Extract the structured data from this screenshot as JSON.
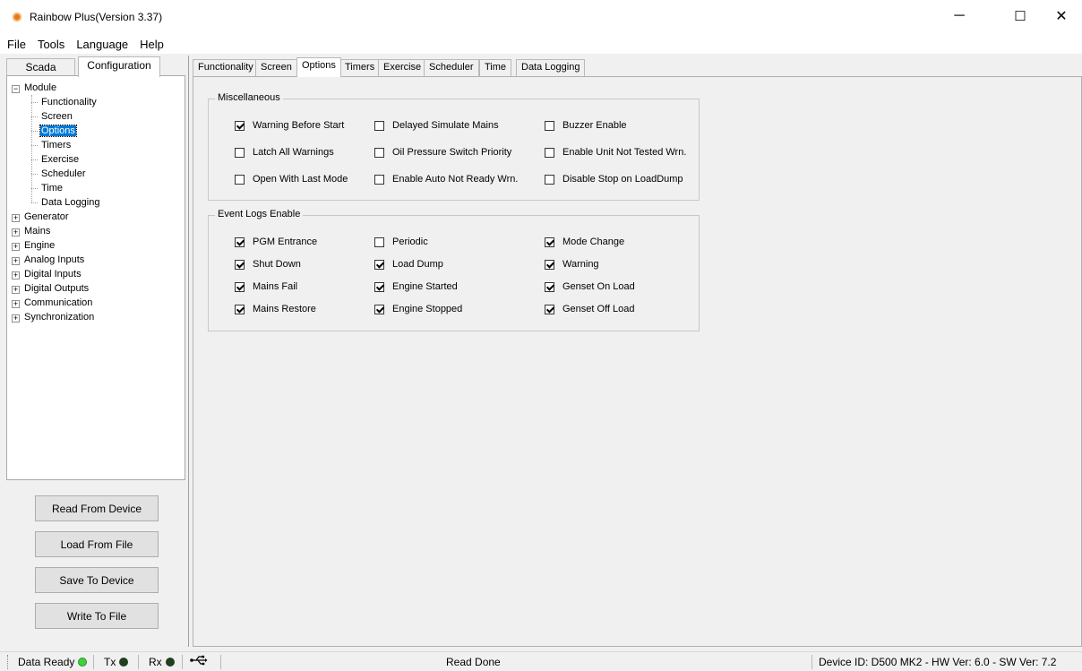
{
  "window": {
    "title": "Rainbow Plus(Version 3.37)",
    "controls": [
      "─",
      "☐",
      "✕"
    ]
  },
  "menu": [
    "File",
    "Tools",
    "Language",
    "Help"
  ],
  "left_tabs": {
    "scada": "Scada",
    "configuration": "Configuration"
  },
  "tree": {
    "module": "Module",
    "children": [
      "Functionality",
      "Screen",
      "Options",
      "Timers",
      "Exercise",
      "Scheduler",
      "Time",
      "Data Logging"
    ],
    "selected": "Options",
    "collapsed": [
      "Generator",
      "Mains",
      "Engine",
      "Analog Inputs",
      "Digital Inputs",
      "Digital Outputs",
      "Communication",
      "Synchronization"
    ]
  },
  "buttons": {
    "read": "Read From Device",
    "load": "Load From File",
    "save": "Save To Device",
    "write": "Write To File"
  },
  "tabs": [
    "Functionality",
    "Screen",
    "Options",
    "Timers",
    "Exercise",
    "Scheduler",
    "Time",
    "Data Logging"
  ],
  "active_tab": "Options",
  "misc": {
    "title": "Miscellaneous",
    "items": [
      {
        "label": "Warning Before Start",
        "checked": true
      },
      {
        "label": "Delayed Simulate Mains",
        "checked": false
      },
      {
        "label": "Buzzer Enable",
        "checked": false
      },
      {
        "label": "Latch All Warnings",
        "checked": false
      },
      {
        "label": "Oil Pressure Switch Priority",
        "checked": false
      },
      {
        "label": "Enable Unit Not Tested Wrn.",
        "checked": false
      },
      {
        "label": "Open With Last Mode",
        "checked": false
      },
      {
        "label": "Enable Auto Not Ready Wrn.",
        "checked": false
      },
      {
        "label": "Disable Stop on LoadDump",
        "checked": false
      }
    ]
  },
  "event_logs": {
    "title": "Event Logs Enable",
    "items": [
      {
        "label": "PGM Entrance",
        "checked": true
      },
      {
        "label": "Periodic",
        "checked": false
      },
      {
        "label": "Mode Change",
        "checked": true
      },
      {
        "label": "Shut Down",
        "checked": true
      },
      {
        "label": "Load Dump",
        "checked": true
      },
      {
        "label": "Warning",
        "checked": true
      },
      {
        "label": "Mains Fail",
        "checked": true
      },
      {
        "label": "Engine Started",
        "checked": true
      },
      {
        "label": "Genset On Load",
        "checked": true
      },
      {
        "label": "Mains Restore",
        "checked": true
      },
      {
        "label": "Engine Stopped",
        "checked": true
      },
      {
        "label": "Genset Off Load",
        "checked": true
      }
    ]
  },
  "status": {
    "data_ready": "Data Ready",
    "tx": "Tx",
    "rx": "Rx",
    "message": "Read Done",
    "device": "Device ID: D500 MK2 - HW Ver: 6.0 - SW Ver: 7.2",
    "colors": {
      "ready": "#3cd33c",
      "tx": "#1f3f1f",
      "rx": "#1f3f1f"
    }
  }
}
